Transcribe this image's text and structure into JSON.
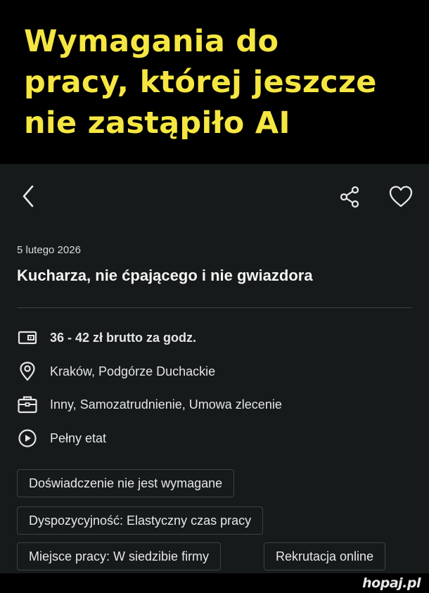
{
  "meme": {
    "title_line1": "Wymagania do",
    "title_line2": "pracy, której jeszcze",
    "title_line3": "nie zastąpiło AI",
    "title_color": "#f5e642"
  },
  "toolbar": {
    "back_icon": "chevron-left-icon",
    "share_icon": "share-icon",
    "favorite_icon": "heart-icon"
  },
  "listing": {
    "date": "5 lutego 2026",
    "title": "Kucharza, nie ćpającego i nie gwiazdora",
    "details": [
      {
        "icon": "wallet-icon",
        "text": "36 - 42 zł brutto za godz."
      },
      {
        "icon": "location-pin-icon",
        "text": "Kraków, Podgórze Duchackie"
      },
      {
        "icon": "briefcase-icon",
        "text": "Inny, Samozatrudnienie, Umowa zlecenie"
      },
      {
        "icon": "clock-icon",
        "text": "Pełny etat"
      }
    ],
    "tags": [
      "Doświadczenie nie jest wymagane",
      "Dyspozycyjność: Elastyczny czas pracy",
      "Miejsce pracy: W siedzibie firmy",
      "Rekrutacja online"
    ]
  },
  "footer": {
    "watermark": "hopaj.pl"
  },
  "colors": {
    "app_background": "#161a1b",
    "text_primary": "#f4f4f4",
    "chip_border": "#3c4244"
  }
}
